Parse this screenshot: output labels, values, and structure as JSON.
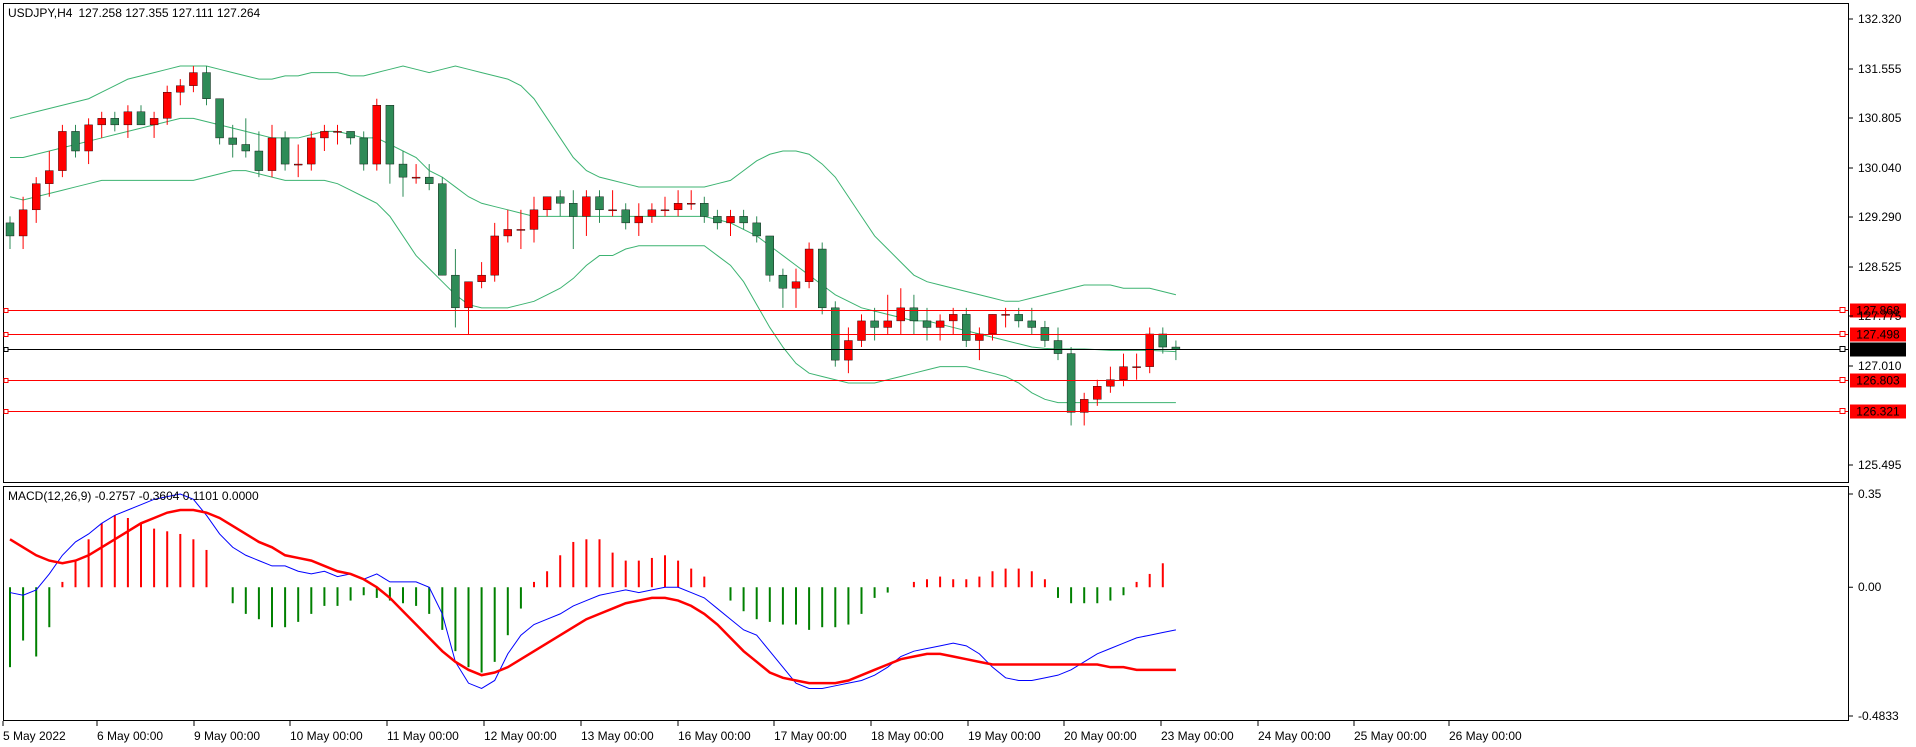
{
  "header": {
    "symbol": "USDJPY,H4",
    "ohlc": "127.258 127.355 127.111 127.264"
  },
  "macd_header": "MACD(12,26,9) -0.2757 -0.3604 0.1101 0.0000",
  "price_axis": {
    "ticks": [
      "132.320",
      "131.555",
      "130.805",
      "130.040",
      "129.290",
      "128.525",
      "127.775",
      "127.010",
      "125.495"
    ]
  },
  "macd_axis": {
    "ticks": [
      "0.35",
      "0.00",
      "-0.4833"
    ]
  },
  "levels": [
    {
      "label": "127.868",
      "color": "#ff0000",
      "bg": "#ff0000"
    },
    {
      "label": "127.498",
      "color": "#ff0000",
      "bg": "#ff0000"
    },
    {
      "label": "127.264",
      "color": "#000000",
      "bg": "#000000"
    },
    {
      "label": "126.803",
      "color": "#ff0000",
      "bg": "#ff0000"
    },
    {
      "label": "126.321",
      "color": "#ff0000",
      "bg": "#ff0000"
    }
  ],
  "time_axis": {
    "labels": [
      "5 May 2022",
      "6 May 00:00",
      "9 May 00:00",
      "10 May 00:00",
      "11 May 00:00",
      "12 May 00:00",
      "13 May 00:00",
      "16 May 00:00",
      "17 May 00:00",
      "18 May 00:00",
      "19 May 00:00",
      "20 May 00:00",
      "23 May 00:00",
      "24 May 00:00",
      "25 May 00:00",
      "26 May 00:00"
    ]
  },
  "colors": {
    "bull": "#ff0000",
    "bear": "#2e8b57",
    "bands": "#3cb371",
    "macd_line": "#0000ff",
    "signal_line": "#ff0000",
    "hist_pos": "#ff0000",
    "hist_neg": "#008000"
  },
  "chart_data": {
    "type": "candlestick",
    "candles": [
      [
        129.2,
        129.3,
        128.8,
        129.0
      ],
      [
        129.0,
        129.6,
        128.8,
        129.4
      ],
      [
        129.4,
        129.9,
        129.2,
        129.8
      ],
      [
        129.8,
        130.3,
        129.6,
        130.0
      ],
      [
        130.0,
        130.7,
        129.9,
        130.6
      ],
      [
        130.6,
        130.7,
        130.2,
        130.3
      ],
      [
        130.3,
        130.8,
        130.1,
        130.7
      ],
      [
        130.7,
        130.9,
        130.5,
        130.8
      ],
      [
        130.8,
        130.9,
        130.6,
        130.7
      ],
      [
        130.7,
        131.0,
        130.5,
        130.9
      ],
      [
        130.9,
        131.0,
        130.7,
        130.7
      ],
      [
        130.7,
        130.9,
        130.5,
        130.8
      ],
      [
        130.8,
        131.3,
        130.7,
        131.2
      ],
      [
        131.2,
        131.4,
        131.0,
        131.3
      ],
      [
        131.3,
        131.6,
        131.2,
        131.5
      ],
      [
        131.5,
        131.6,
        131.0,
        131.1
      ],
      [
        131.1,
        131.1,
        130.4,
        130.5
      ],
      [
        130.5,
        130.7,
        130.2,
        130.4
      ],
      [
        130.4,
        130.8,
        130.2,
        130.3
      ],
      [
        130.3,
        130.6,
        129.9,
        130.0
      ],
      [
        130.0,
        130.7,
        129.9,
        130.5
      ],
      [
        130.5,
        130.6,
        130.0,
        130.1
      ],
      [
        130.1,
        130.4,
        129.9,
        130.1
      ],
      [
        130.1,
        130.6,
        130.0,
        130.5
      ],
      [
        130.5,
        130.7,
        130.3,
        130.6
      ],
      [
        130.6,
        130.7,
        130.4,
        130.6
      ],
      [
        130.6,
        130.6,
        130.4,
        130.5
      ],
      [
        130.5,
        130.6,
        130.0,
        130.1
      ],
      [
        130.1,
        131.1,
        130.0,
        131.0
      ],
      [
        131.0,
        131.0,
        129.8,
        130.1
      ],
      [
        130.1,
        130.3,
        129.6,
        129.9
      ],
      [
        129.9,
        130.1,
        129.8,
        129.9
      ],
      [
        129.9,
        130.1,
        129.7,
        129.8
      ],
      [
        129.8,
        129.9,
        128.4,
        128.4
      ],
      [
        128.4,
        128.8,
        127.6,
        127.9
      ],
      [
        127.9,
        128.3,
        127.5,
        128.3
      ],
      [
        128.3,
        128.6,
        128.2,
        128.4
      ],
      [
        128.4,
        129.2,
        128.3,
        129.0
      ],
      [
        129.0,
        129.4,
        128.9,
        129.1
      ],
      [
        129.1,
        129.4,
        128.8,
        129.1
      ],
      [
        129.1,
        129.6,
        128.9,
        129.4
      ],
      [
        129.4,
        129.6,
        129.3,
        129.6
      ],
      [
        129.6,
        129.7,
        129.3,
        129.5
      ],
      [
        129.5,
        129.7,
        128.8,
        129.3
      ],
      [
        129.3,
        129.7,
        129.0,
        129.6
      ],
      [
        129.6,
        129.7,
        129.2,
        129.4
      ],
      [
        129.4,
        129.7,
        129.3,
        129.4
      ],
      [
        129.4,
        129.5,
        129.1,
        129.2
      ],
      [
        129.2,
        129.5,
        129.0,
        129.3
      ],
      [
        129.3,
        129.5,
        129.2,
        129.4
      ],
      [
        129.4,
        129.6,
        129.3,
        129.4
      ],
      [
        129.4,
        129.7,
        129.3,
        129.5
      ],
      [
        129.5,
        129.7,
        129.4,
        129.5
      ],
      [
        129.5,
        129.6,
        129.2,
        129.3
      ],
      [
        129.3,
        129.4,
        129.1,
        129.2
      ],
      [
        129.2,
        129.4,
        129.0,
        129.3
      ],
      [
        129.3,
        129.4,
        129.1,
        129.2
      ],
      [
        129.2,
        129.3,
        128.9,
        129.0
      ],
      [
        129.0,
        129.0,
        128.3,
        128.4
      ],
      [
        128.4,
        128.5,
        127.9,
        128.2
      ],
      [
        128.2,
        128.5,
        127.9,
        128.3
      ],
      [
        128.3,
        128.9,
        128.2,
        128.8
      ],
      [
        128.8,
        128.9,
        127.8,
        127.9
      ],
      [
        127.9,
        128.0,
        127.0,
        127.1
      ],
      [
        127.1,
        127.6,
        126.9,
        127.4
      ],
      [
        127.4,
        127.8,
        127.3,
        127.7
      ],
      [
        127.7,
        127.9,
        127.4,
        127.6
      ],
      [
        127.6,
        128.1,
        127.5,
        127.7
      ],
      [
        127.7,
        128.2,
        127.5,
        127.9
      ],
      [
        127.9,
        128.1,
        127.5,
        127.7
      ],
      [
        127.7,
        127.9,
        127.4,
        127.6
      ],
      [
        127.6,
        127.8,
        127.4,
        127.7
      ],
      [
        127.7,
        127.9,
        127.5,
        127.8
      ],
      [
        127.8,
        127.9,
        127.3,
        127.4
      ],
      [
        127.4,
        127.6,
        127.1,
        127.5
      ],
      [
        127.5,
        127.8,
        127.4,
        127.8
      ],
      [
        127.8,
        127.9,
        127.6,
        127.8
      ],
      [
        127.8,
        127.9,
        127.6,
        127.7
      ],
      [
        127.7,
        127.9,
        127.5,
        127.6
      ],
      [
        127.6,
        127.7,
        127.3,
        127.4
      ],
      [
        127.4,
        127.6,
        127.1,
        127.2
      ],
      [
        127.2,
        127.3,
        126.1,
        126.3
      ],
      [
        126.3,
        126.6,
        126.1,
        126.5
      ],
      [
        126.5,
        126.8,
        126.4,
        126.7
      ],
      [
        126.7,
        127.0,
        126.6,
        126.8
      ],
      [
        126.8,
        127.2,
        126.7,
        127.0
      ],
      [
        127.0,
        127.2,
        126.8,
        127.0
      ],
      [
        127.0,
        127.6,
        126.9,
        127.5
      ],
      [
        127.5,
        127.6,
        127.2,
        127.3
      ],
      [
        127.3,
        127.4,
        127.1,
        127.26
      ]
    ],
    "macd_histogram": [
      -0.3,
      -0.2,
      -0.26,
      -0.15,
      0.02,
      0.1,
      0.18,
      0.24,
      0.27,
      0.26,
      0.24,
      0.22,
      0.21,
      0.2,
      0.18,
      0.14,
      0.0,
      -0.06,
      -0.1,
      -0.12,
      -0.15,
      -0.15,
      -0.13,
      -0.1,
      -0.07,
      -0.07,
      -0.05,
      -0.03,
      -0.04,
      -0.05,
      -0.06,
      -0.07,
      -0.1,
      -0.16,
      -0.24,
      -0.3,
      -0.32,
      -0.28,
      -0.18,
      -0.08,
      0.02,
      0.06,
      0.12,
      0.17,
      0.18,
      0.18,
      0.13,
      0.1,
      0.1,
      0.11,
      0.12,
      0.1,
      0.07,
      0.04,
      0.0,
      -0.05,
      -0.09,
      -0.12,
      -0.13,
      -0.14,
      -0.14,
      -0.16,
      -0.15,
      -0.15,
      -0.14,
      -0.1,
      -0.04,
      -0.02,
      0.0,
      0.02,
      0.03,
      0.04,
      0.03,
      0.03,
      0.04,
      0.06,
      0.07,
      0.07,
      0.06,
      0.03,
      -0.04,
      -0.06,
      -0.06,
      -0.06,
      -0.05,
      -0.03,
      0.02,
      0.05,
      0.09
    ],
    "macd_line": [
      -0.02,
      -0.03,
      -0.01,
      0.05,
      0.12,
      0.17,
      0.2,
      0.24,
      0.27,
      0.29,
      0.31,
      0.33,
      0.34,
      0.35,
      0.33,
      0.27,
      0.2,
      0.15,
      0.12,
      0.1,
      0.08,
      0.08,
      0.06,
      0.05,
      0.06,
      0.04,
      0.05,
      0.03,
      0.05,
      0.02,
      0.02,
      0.02,
      0.0,
      -0.1,
      -0.28,
      -0.36,
      -0.38,
      -0.35,
      -0.25,
      -0.18,
      -0.14,
      -0.12,
      -0.1,
      -0.07,
      -0.05,
      -0.03,
      -0.02,
      -0.01,
      -0.02,
      -0.01,
      0.0,
      0.0,
      -0.02,
      -0.04,
      -0.08,
      -0.12,
      -0.16,
      -0.18,
      -0.24,
      -0.3,
      -0.36,
      -0.38,
      -0.38,
      -0.37,
      -0.36,
      -0.35,
      -0.33,
      -0.3,
      -0.26,
      -0.24,
      -0.23,
      -0.22,
      -0.21,
      -0.22,
      -0.25,
      -0.3,
      -0.34,
      -0.35,
      -0.35,
      -0.34,
      -0.33,
      -0.31,
      -0.28,
      -0.25,
      -0.23,
      -0.21,
      -0.19,
      -0.18,
      -0.17,
      -0.16
    ],
    "signal_line": [
      0.18,
      0.15,
      0.12,
      0.1,
      0.09,
      0.1,
      0.12,
      0.15,
      0.18,
      0.21,
      0.24,
      0.26,
      0.28,
      0.29,
      0.29,
      0.28,
      0.26,
      0.23,
      0.2,
      0.17,
      0.15,
      0.12,
      0.11,
      0.1,
      0.08,
      0.06,
      0.05,
      0.03,
      0.0,
      -0.04,
      -0.09,
      -0.14,
      -0.19,
      -0.24,
      -0.28,
      -0.31,
      -0.33,
      -0.32,
      -0.3,
      -0.27,
      -0.24,
      -0.21,
      -0.18,
      -0.15,
      -0.12,
      -0.1,
      -0.08,
      -0.06,
      -0.05,
      -0.04,
      -0.04,
      -0.05,
      -0.07,
      -0.1,
      -0.14,
      -0.19,
      -0.24,
      -0.28,
      -0.32,
      -0.34,
      -0.35,
      -0.36,
      -0.36,
      -0.36,
      -0.35,
      -0.33,
      -0.31,
      -0.29,
      -0.27,
      -0.26,
      -0.25,
      -0.25,
      -0.26,
      -0.27,
      -0.28,
      -0.29,
      -0.29,
      -0.29,
      -0.29,
      -0.29,
      -0.29,
      -0.29,
      -0.29,
      -0.29,
      -0.3,
      -0.3,
      -0.31,
      -0.31,
      -0.31,
      -0.31
    ],
    "bollinger_upper": [
      130.8,
      130.85,
      130.9,
      130.95,
      131.0,
      131.05,
      131.1,
      131.2,
      131.3,
      131.4,
      131.45,
      131.5,
      131.55,
      131.6,
      131.6,
      131.6,
      131.55,
      131.5,
      131.45,
      131.4,
      131.4,
      131.45,
      131.45,
      131.5,
      131.5,
      131.5,
      131.45,
      131.45,
      131.5,
      131.55,
      131.6,
      131.55,
      131.5,
      131.55,
      131.6,
      131.55,
      131.5,
      131.45,
      131.4,
      131.3,
      131.1,
      130.8,
      130.5,
      130.2,
      130.0,
      129.9,
      129.85,
      129.8,
      129.75,
      129.75,
      129.75,
      129.75,
      129.75,
      129.75,
      129.8,
      129.85,
      130.0,
      130.15,
      130.25,
      130.3,
      130.3,
      130.25,
      130.1,
      129.9,
      129.6,
      129.3,
      129.0,
      128.8,
      128.6,
      128.4,
      128.3,
      128.25,
      128.2,
      128.15,
      128.1,
      128.05,
      128.0,
      128.0,
      128.05,
      128.1,
      128.15,
      128.2,
      128.25,
      128.25,
      128.25,
      128.2,
      128.2,
      128.2,
      128.15,
      128.1
    ],
    "bollinger_middle": [
      130.2,
      130.2,
      130.25,
      130.3,
      130.35,
      130.4,
      130.45,
      130.5,
      130.55,
      130.6,
      130.65,
      130.7,
      130.75,
      130.8,
      130.8,
      130.75,
      130.7,
      130.65,
      130.6,
      130.55,
      130.5,
      130.5,
      130.5,
      130.55,
      130.6,
      130.6,
      130.55,
      130.5,
      130.5,
      130.4,
      130.3,
      130.2,
      130.0,
      129.9,
      129.75,
      129.6,
      129.5,
      129.45,
      129.4,
      129.35,
      129.3,
      129.3,
      129.3,
      129.3,
      129.3,
      129.3,
      129.3,
      129.3,
      129.3,
      129.3,
      129.3,
      129.3,
      129.3,
      129.3,
      129.25,
      129.2,
      129.1,
      129.0,
      128.85,
      128.7,
      128.55,
      128.4,
      128.25,
      128.1,
      128.0,
      127.9,
      127.85,
      127.8,
      127.75,
      127.7,
      127.7,
      127.65,
      127.6,
      127.55,
      127.5,
      127.45,
      127.4,
      127.35,
      127.3,
      127.28,
      127.27,
      127.27,
      127.27,
      127.26,
      127.25,
      127.25,
      127.25,
      127.25,
      127.24,
      127.23
    ],
    "bollinger_lower": [
      129.6,
      129.55,
      129.6,
      129.65,
      129.7,
      129.75,
      129.8,
      129.85,
      129.85,
      129.85,
      129.85,
      129.85,
      129.85,
      129.85,
      129.85,
      129.9,
      129.95,
      130.0,
      130.0,
      129.95,
      129.9,
      129.85,
      129.85,
      129.85,
      129.85,
      129.8,
      129.7,
      129.6,
      129.5,
      129.3,
      129.0,
      128.7,
      128.5,
      128.3,
      128.1,
      127.95,
      127.9,
      127.9,
      127.9,
      127.95,
      128.0,
      128.1,
      128.2,
      128.35,
      128.55,
      128.7,
      128.7,
      128.8,
      128.85,
      128.85,
      128.85,
      128.85,
      128.85,
      128.85,
      128.7,
      128.55,
      128.3,
      127.95,
      127.6,
      127.3,
      127.05,
      126.9,
      126.85,
      126.8,
      126.75,
      126.75,
      126.75,
      126.8,
      126.85,
      126.9,
      126.95,
      127.0,
      127.0,
      127.0,
      126.95,
      126.9,
      126.85,
      126.75,
      126.6,
      126.5,
      126.45,
      126.45,
      126.45,
      126.45,
      126.45,
      126.45,
      126.45,
      126.45,
      126.45,
      126.45
    ]
  }
}
